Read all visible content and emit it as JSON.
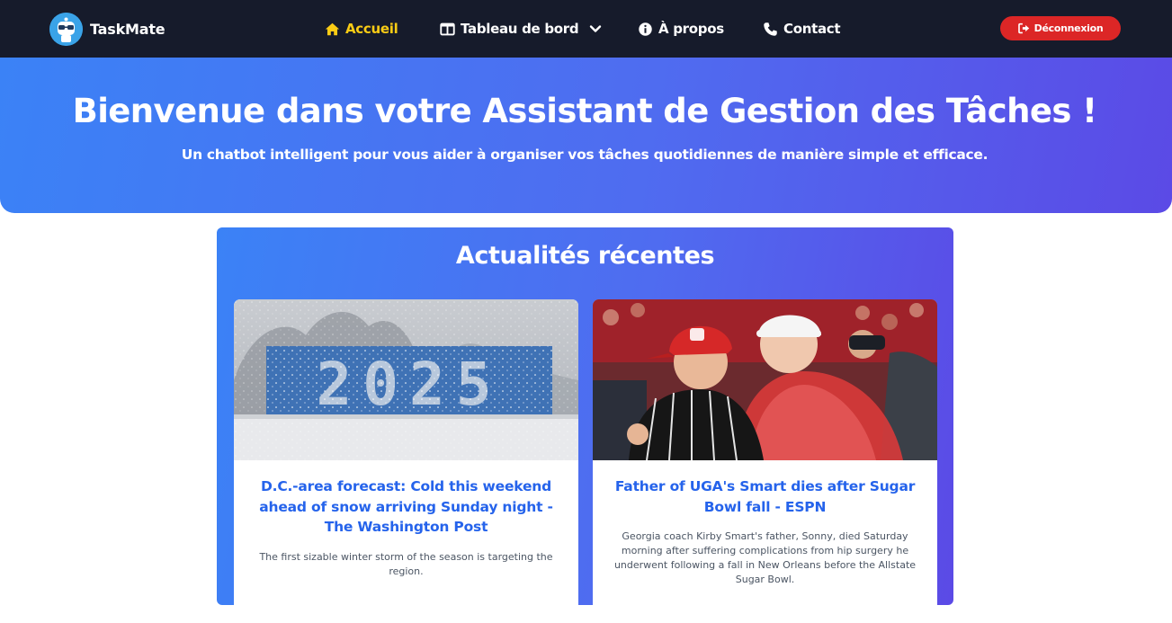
{
  "brand": {
    "name": "TaskMate",
    "logo_icon": "robot-glasses-icon"
  },
  "nav": {
    "home": {
      "label": "Accueil",
      "icon": "home-icon",
      "color": "#facc15"
    },
    "dashboard": {
      "label": "Tableau de bord",
      "icon": "columns-icon"
    },
    "about": {
      "label": "À propos",
      "icon": "info-icon"
    },
    "contact": {
      "label": "Contact",
      "icon": "phone-icon"
    },
    "logout": {
      "label": "Déconnexion",
      "icon": "sign-out-icon",
      "color": "#dc2626"
    }
  },
  "hero": {
    "title": "Bienvenue dans votre Assistant de Gestion des Tâches !",
    "subtitle": "Un chatbot intelligent pour vous aider à organiser vos tâches quotidiennes de manière simple et efficace."
  },
  "news": {
    "title": "Actualités récentes",
    "articles": [
      {
        "title": "D.C.-area forecast: Cold this weekend ahead of snow arriving Sunday night - The Washington Post",
        "description": "The first sizable winter storm of the season is targeting the region.",
        "image_text": "2025"
      },
      {
        "title": "Father of UGA's Smart dies after Sugar Bowl fall - ESPN",
        "description": "Georgia coach Kirby Smart's father, Sonny, died Saturday morning after suffering complications from hip surgery he underwent following a fall in New Orleans before the Allstate Sugar Bowl."
      }
    ]
  },
  "colors": {
    "navbar": "#161b2b",
    "gradient_start": "#3b82f6",
    "gradient_end": "#5b4ae6",
    "link": "#2563eb"
  }
}
